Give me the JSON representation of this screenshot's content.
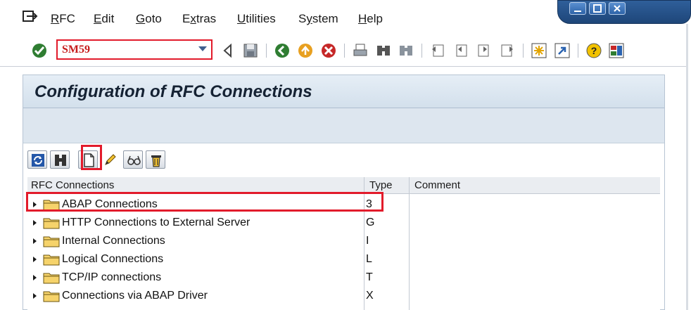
{
  "menubar": {
    "items": [
      "RFC",
      "Edit",
      "Goto",
      "Extras",
      "Utilities",
      "System",
      "Help"
    ],
    "underline_chars": [
      "R",
      "E",
      "G",
      "x",
      "U",
      "y",
      "H"
    ]
  },
  "toolbar": {
    "command_value": "SM59"
  },
  "page": {
    "title": "Configuration of RFC Connections"
  },
  "tree": {
    "headers": {
      "name": "RFC Connections",
      "type": "Type",
      "comment": "Comment"
    },
    "rows": [
      {
        "label": "ABAP Connections",
        "type": "3"
      },
      {
        "label": "HTTP Connections to External Server",
        "type": "G"
      },
      {
        "label": "Internal Connections",
        "type": "I"
      },
      {
        "label": "Logical Connections",
        "type": "L"
      },
      {
        "label": "TCP/IP connections",
        "type": "T"
      },
      {
        "label": "Connections via ABAP Driver",
        "type": "X"
      }
    ]
  },
  "colors": {
    "highlight": "#e21b2b",
    "title_bg": "#d3e0ec",
    "command_text": "#c61b1b"
  },
  "icons": {
    "menu": "menu-icon",
    "enter": "checkmark-icon",
    "back_arrow": "back-arrow-icon",
    "save": "save-icon",
    "back": "back-icon",
    "exit": "exit-icon",
    "cancel": "cancel-icon",
    "print": "print-icon",
    "find": "find-icon",
    "find_next": "find-next-icon",
    "first_page": "first-page-icon",
    "prev_page": "prev-page-icon",
    "next_page": "next-page-icon",
    "last_page": "last-page-icon",
    "new_session": "new-session-icon",
    "shortcut": "shortcut-icon",
    "help": "help-icon",
    "layout": "layout-icon",
    "refresh": "refresh-icon",
    "db_save": "db-save-icon",
    "create": "create-icon",
    "change": "pencil-icon",
    "display": "glasses-icon",
    "delete": "trash-icon",
    "folder": "folder-icon"
  }
}
